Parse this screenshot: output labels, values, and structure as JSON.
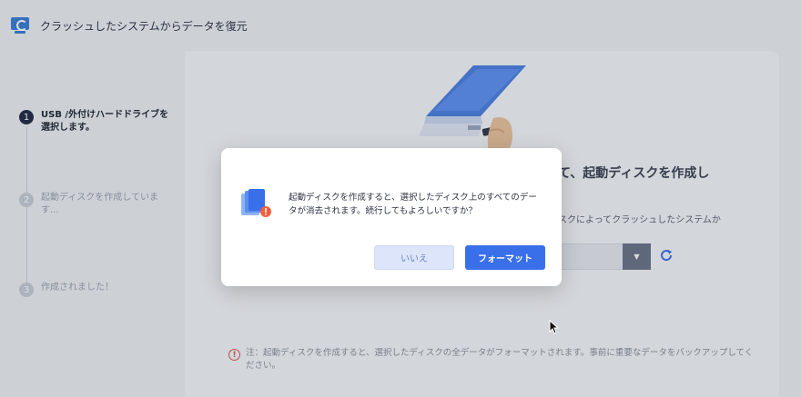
{
  "app": {
    "title": "クラッシュしたシステムからデータを復元",
    "icon": "monitor-restore-icon"
  },
  "steps": [
    {
      "num": "1",
      "label": "USB /外付けハードドライブを選択します。",
      "active": true
    },
    {
      "num": "2",
      "label": "起動ディスクを作成しています...",
      "active": false
    },
    {
      "num": "3",
      "label": "作成されました！",
      "active": false
    }
  ],
  "main": {
    "heading": "て、起動ディスクを作成し",
    "description": "スクによってクラッシュしたシステムか",
    "drive_select_value": "",
    "note": "注：起動ディスクを作成すると、選択したディスクの全データがフォーマットされます。事前に重要なデータをバックアップしてください。"
  },
  "dialog": {
    "message": "起動ディスクを作成すると、選択したディスク上のすべてのデータが消去されます。続行してもよろしいですか？",
    "no_label": "いいえ",
    "format_label": "フォーマット"
  },
  "colors": {
    "accent": "#3a6fea",
    "warning": "#d9534f"
  }
}
